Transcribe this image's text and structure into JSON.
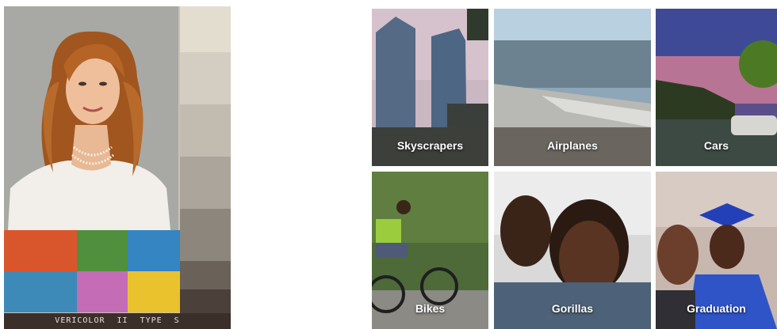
{
  "print": {
    "caption": "VERICOLOR II TYPE S",
    "gray_scale": [
      "#e3ddd0",
      "#d4cec2",
      "#c1bbb0",
      "#aba59b",
      "#8d867d",
      "#6a6158",
      "#4b413a",
      "#3a2f29"
    ],
    "swatch_colors": [
      "#d9562d",
      "#4f8f3e",
      "#3485c2",
      "#3d8ab8",
      "#c46cb6",
      "#e9c22e"
    ]
  },
  "photo_grid": {
    "tiles": [
      {
        "label": "Skyscrapers"
      },
      {
        "label": "Airplanes"
      },
      {
        "label": "Cars"
      },
      {
        "label": "Bikes"
      },
      {
        "label": "Gorillas"
      },
      {
        "label": "Graduation"
      }
    ]
  }
}
